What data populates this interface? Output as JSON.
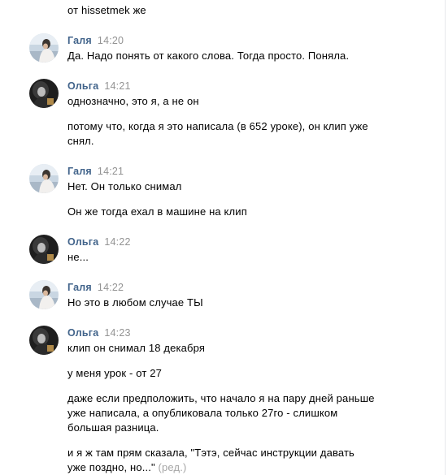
{
  "messages": {
    "prev_fragment": "от hissetmek же",
    "g1": {
      "author": "Галя",
      "time": "14:20",
      "text1": "Да. Надо понять от какого слова. Тогда просто. Поняла."
    },
    "o1": {
      "author": "Ольга",
      "time": "14:21",
      "text1": "однозначно, это я, а не он",
      "text2_line1": "потому что, когда я это написала (в 652 уроке), он клип уже",
      "text2_line2": "снял."
    },
    "g2": {
      "author": "Галя",
      "time": "14:21",
      "text1": "Нет. Он только снимал",
      "text2": "Он же тогда ехал в машине на клип"
    },
    "o2": {
      "author": "Ольга",
      "time": "14:22",
      "text1": "не..."
    },
    "g3": {
      "author": "Галя",
      "time": "14:22",
      "text1": "Но это в любом случае ТЫ"
    },
    "o3": {
      "author": "Ольга",
      "time": "14:23",
      "text1": "клип он снимал 18 декабря",
      "text2": "у меня урок - от 27",
      "text3_line1": "даже если предположить, что начало я на пару дней раньше",
      "text3_line2": "уже написала, а опубликовала только 27го - слишком",
      "text3_line3": "большая разница.",
      "text4_line1": "и я ж там прям сказала, \"Тэтэ, сейчас инструкции давать",
      "text4_line2": "уже поздно, но...\"",
      "edited_label": "(ред.)"
    }
  },
  "colors": {
    "author_name": "#42648b",
    "timestamp": "#939393",
    "edited": "#a6a6a6",
    "text": "#000000"
  }
}
